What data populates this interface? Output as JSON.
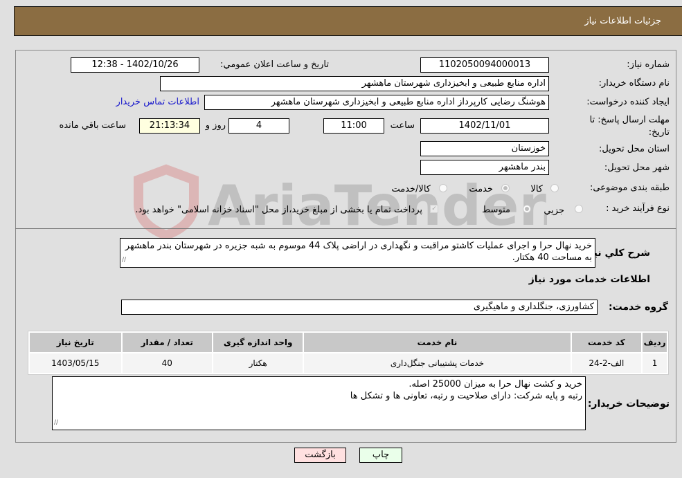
{
  "header": {
    "title": "جزئیات اطلاعات نیاز"
  },
  "form": {
    "need_number_label": "شماره نیاز:",
    "need_number": "1102050094000013",
    "announce_label": "تاریخ و ساعت اعلان عمومي:",
    "announce_value": "1402/10/26 - 12:38",
    "buyer_org_label": "نام دستگاه خریدار:",
    "buyer_org": "اداره منابع طبیعی و ابخیزداری شهرستان ماهشهر",
    "creator_label": "ایجاد کننده درخواست:",
    "creator": "هوشنگ رضایی کارپرداز اداره منابع طبیعی و ابخیزداری شهرستان ماهشهر",
    "contact_link": "اطلاعات تماس خریدار",
    "deadline_label": "مهلت ارسال پاسخ: تا تاریخ:",
    "deadline_date": "1402/11/01",
    "time_label": "ساعت",
    "deadline_time": "11:00",
    "days": "4",
    "days_label": "روز و",
    "remaining": "21:13:34",
    "remaining_label": "ساعت باقي مانده",
    "province_label": "استان محل تحویل:",
    "province": "خوزستان",
    "city_label": "شهر محل تحویل:",
    "city": "بندر ماهشهر",
    "category_label": "طبقه بندی موضوعی:",
    "category_options": [
      {
        "label": "کالا",
        "checked": false
      },
      {
        "label": "خدمت",
        "checked": true
      },
      {
        "label": "کالا/خدمت",
        "checked": false
      }
    ],
    "process_label": "نوع فرآیند خرید :",
    "process_options": [
      {
        "label": "جزيي",
        "checked": false
      },
      {
        "label": "متوسط",
        "checked": true
      }
    ],
    "treasury_note": "پرداخت تمام یا بخشی از مبلغ خرید،از محل \"اسناد خزانه اسلامی\" خواهد بود.",
    "treasury_checked": true
  },
  "description": {
    "label": "شرح کلي نیاز:",
    "text": "خرید نهال حرا و اجرای عملیات کاشتو مراقبت و نگهداری در اراضی پلاک 44 موسوم به شبه جزیره در شهرستان بندر ماهشهر به مساحت 40 هکتار."
  },
  "services": {
    "section_title": "اطلاعات خدمات مورد نیاز",
    "group_label": "گروه خدمت:",
    "group_value": "کشاورزی، جنگلداری و ماهیگیری",
    "columns": [
      "ردیف",
      "کد خدمت",
      "نام خدمت",
      "واحد اندازه گیری",
      "تعداد / مقدار",
      "تاریخ نیاز"
    ],
    "rows": [
      [
        "1",
        "الف-2-24",
        "خدمات پشتیبانی جنگل‌داری",
        "هکتار",
        "40",
        "1403/05/15"
      ]
    ]
  },
  "buyer_notes": {
    "label": "توضیحات خریدار:",
    "line1": "خرید و کشت نهال حرا به میزان 25000 اصله.",
    "line2": "رتبه و پایه شرکت: دارای صلاحیت و رتبه، تعاونی ها و تشکل ها"
  },
  "buttons": {
    "print": "چاپ",
    "back": "بازگشت"
  },
  "watermark": {
    "text": "AriaTender.neT"
  },
  "colors": {
    "header": "#8b6d42",
    "print_bg": "#eaffea",
    "back_bg": "#ffe0e0",
    "link": "#1a1acc"
  }
}
